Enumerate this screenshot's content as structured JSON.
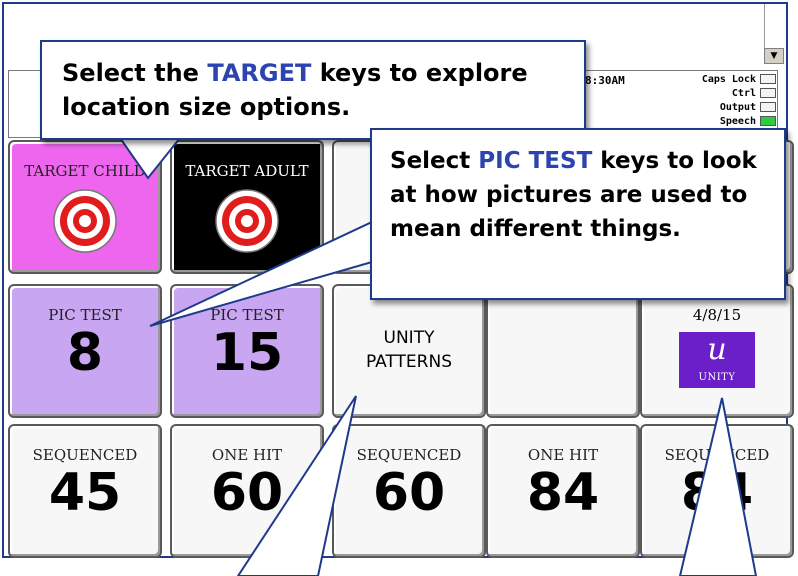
{
  "header": {
    "clock": "8:30AM",
    "status": [
      {
        "label": "Caps Lock",
        "on": false
      },
      {
        "label": "Ctrl",
        "on": false
      },
      {
        "label": "Output",
        "on": false
      },
      {
        "label": "Speech",
        "on": true
      }
    ]
  },
  "callouts": {
    "target": {
      "pre": "Select the ",
      "highlight": "TARGET",
      "post": " keys to explore location size options."
    },
    "pictest": {
      "pre": "Select ",
      "highlight": "PIC TEST",
      "post": " keys to look at how pictures are used to mean different things."
    }
  },
  "keys": {
    "r1c1": {
      "label": "TARGET CHILD",
      "icon": "target-icon"
    },
    "r1c2": {
      "label": "TARGET ADULT",
      "icon": "target-icon"
    },
    "r2c1": {
      "label": "PIC TEST",
      "number": "8"
    },
    "r2c2": {
      "label": "PIC TEST",
      "number": "15"
    },
    "r2c3": {
      "line1": "UNITY",
      "line2": "PATTERNS"
    },
    "r2c5": {
      "date": "4/8/15",
      "logo_text": "UNITY",
      "logo_glyph": "u"
    },
    "r3c1": {
      "label": "SEQUENCED",
      "number": "45"
    },
    "r3c2": {
      "label": "ONE HIT",
      "number": "60"
    },
    "r3c3": {
      "label": "SEQUENCED",
      "number": "60"
    },
    "r3c4": {
      "label": "ONE HIT",
      "number": "84"
    },
    "r3c5": {
      "label": "SEQUENCED",
      "number": "84"
    }
  },
  "colors": {
    "pink_key": "#ee66ee",
    "black_key": "#000000",
    "purple_key": "#c8a6f2",
    "callout_border": "#1f3a8a",
    "highlight": "#2b44b0",
    "logo": "#6a1fc8"
  }
}
